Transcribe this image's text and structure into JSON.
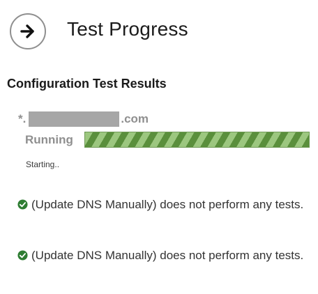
{
  "header": {
    "next_icon": "arrow-right-circle-icon",
    "title": "Test Progress"
  },
  "section": {
    "heading": "Configuration Test Results"
  },
  "test": {
    "domain_prefix": "*.",
    "domain_suffix": ".com",
    "status": "Running",
    "progress_percent": 100,
    "progress_style": "indeterminate-striped",
    "progress_color": "#5a8f3c",
    "progress_stripe_color": "#9cc77f",
    "detail": "Starting.."
  },
  "results": [
    {
      "icon": "check-circle-icon",
      "icon_color": "#2e7d32",
      "text": "(Update DNS Manually) does not perform any tests."
    },
    {
      "icon": "check-circle-icon",
      "icon_color": "#2e7d32",
      "text": "(Update DNS Manually) does not perform any tests."
    }
  ]
}
